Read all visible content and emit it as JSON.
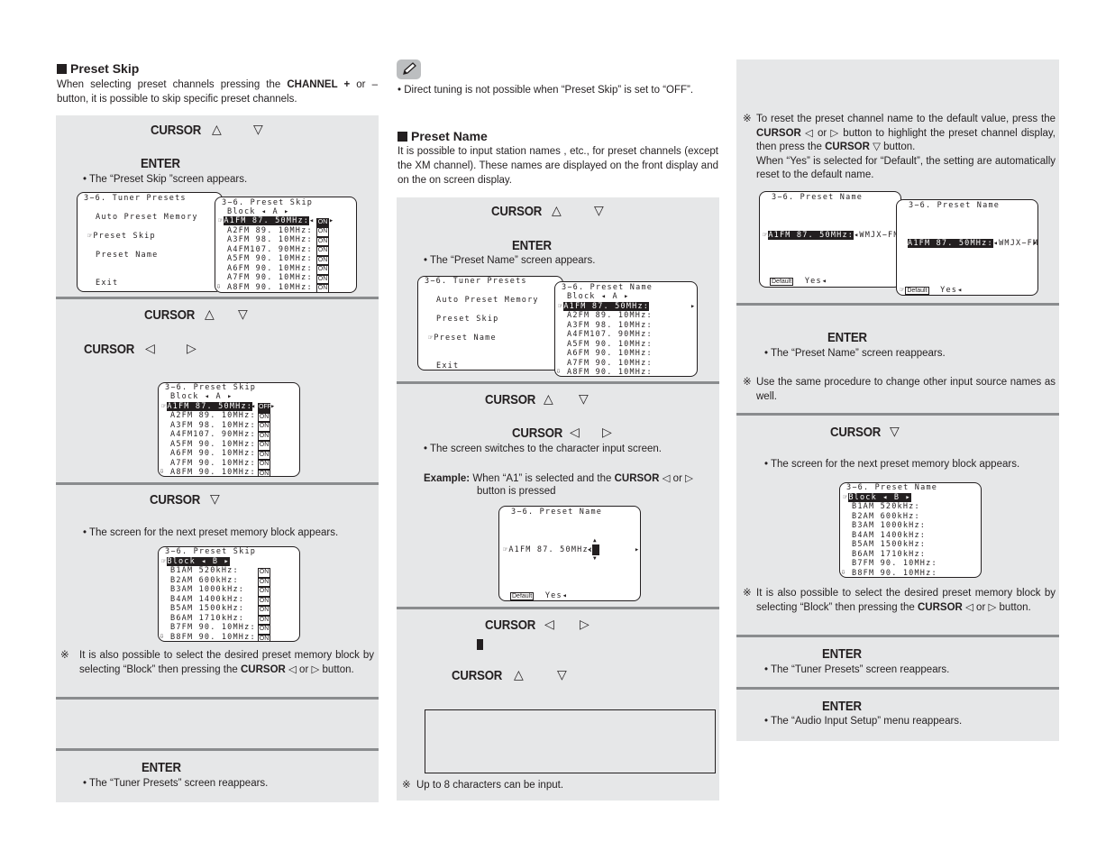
{
  "col1": {
    "heading": "Preset Skip",
    "intro_pre": "When selecting preset channels pressing the ",
    "intro_bold": "CHANNEL +",
    "intro_post": " or – button, it is possible to skip specific preset channels.",
    "step1_key": "CURSOR",
    "step2_key": "ENTER",
    "step2_bullet": "• The “Preset Skip ”screen appears.",
    "step3_key": "CURSOR",
    "step4_key": "CURSOR",
    "step5_key": "CURSOR",
    "step5_bullet": "• The screen for the next preset memory block appears.",
    "note_pre": "It is also possible to select the desired preset memory block by selecting “Block” then pressing the ",
    "note_bold": "CURSOR",
    "note_post": " ◁ or ▷ button.",
    "step7_key": "ENTER",
    "step7_bullet": "• The “Tuner Presets” screen reappears."
  },
  "col2": {
    "memo_bullet": "• Direct tuning is not possible when “Preset Skip” is set to “OFF”.",
    "heading": "Preset Name",
    "intro": "It is possible to input station names , etc., for preset channels (except the XM channel). These names are displayed on the front display and on the on screen display.",
    "step1_key": "CURSOR",
    "step2_key": "ENTER",
    "step2_bullet": "• The “Preset Name” screen appears.",
    "step3_key": "CURSOR",
    "step4_key": "CURSOR",
    "step4_bullet": "• The screen switches to the character input screen.",
    "example_label": "Example:",
    "example_pre": " When “A1” is selected and the ",
    "example_bold": "CURSOR",
    "example_post": " ◁ or ▷",
    "example_line2": "button is pressed",
    "step5_key": "CURSOR",
    "step6_key": "CURSOR",
    "note": "Up to 8 characters can be input."
  },
  "col3": {
    "note1_pre": "To reset the preset channel name to the default value, press the ",
    "note1_bold1": "CURSOR",
    "note1_mid": " ◁ or ▷ button to highlight the preset channel display, then press the ",
    "note1_bold2": "CURSOR",
    "note1_post": " ▽ button.",
    "note1_line2": "When “Yes” is selected for “Default”, the setting are automatically reset to the default name.",
    "step_enter1_key": "ENTER",
    "step_enter1_bullet": "• The “Preset Name” screen reappears.",
    "note2": "Use the same procedure to change other input source names as well.",
    "step_cursor_key": "CURSOR",
    "step_cursor_bullet": "• The screen for the next preset memory block appears.",
    "note3_pre": "It is also possible to select the desired preset memory block by selecting “Block” then pressing the ",
    "note3_bold": "CURSOR",
    "note3_post": " ◁ or ▷ button.",
    "step_enter2_key": "ENTER",
    "step_enter2_bullet": "• The “Tuner Presets” screen reappears.",
    "step_enter3_key": "ENTER",
    "step_enter3_bullet": "• The “Audio Input Setup” menu reappears."
  },
  "symbols": {
    "up": "△",
    "down": "▽",
    "left": "◁",
    "right": "▷",
    "note_mark": "※",
    "pointer": "☞",
    "scroll_down": "⇩",
    "arrow_l": "◂",
    "arrow_r": "▸",
    "cursor_block": "█"
  },
  "osd": {
    "tuner_presets": {
      "title": "3−6. Tuner Presets",
      "items": [
        "Auto Preset Memory",
        "Preset Skip",
        "Preset Name",
        "Exit"
      ]
    },
    "skip_title": "3−6. Preset Skip",
    "name_title": "3−6. Preset Name",
    "block_a": "Block ◂ A ▸",
    "block_b": "Block ◂ B ▸",
    "block_a_rows": [
      "A1FM  87. 50MHz:",
      "A2FM  89. 10MHz:",
      "A3FM  98. 10MHz:",
      "A4FM107. 90MHz:",
      "A5FM  90. 10MHz:",
      "A6FM  90. 10MHz:",
      "A7FM  90. 10MHz:",
      "A8FM  90. 10MHz:"
    ],
    "block_b_rows": [
      "B1AM     520kHz:",
      "B2AM     600kHz:",
      "B3AM    1000kHz:",
      "B4AM    1400kHz:",
      "B5AM    1500kHz:",
      "B6AM    1710kHz:",
      "B7FM  90. 10MHz:",
      "B8FM  90. 10MHz:"
    ],
    "on": "ON",
    "off": "OFF",
    "char_row": "A1FM  87. 50MHz:",
    "name_value": "WMJX−FM",
    "default_label": "Default",
    "yes_label": "Yes"
  }
}
